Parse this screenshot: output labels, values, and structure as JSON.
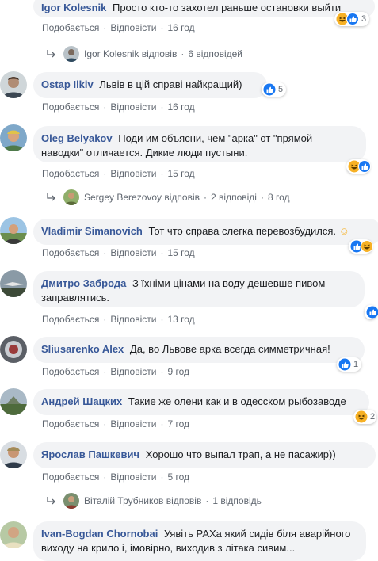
{
  "actions": {
    "like": "Подобається",
    "reply": "Відповісти",
    "dot": "·"
  },
  "comments": [
    {
      "author": "Igor Kolesnik",
      "text": "Просто кто-то захотел раньше остановки выйти",
      "time": "16 год",
      "reactions": "3"
    },
    {
      "author": "Ostap Ilkiv",
      "text": "Львів в цій справі найкращий)",
      "time": "16 год",
      "reactions": "5"
    },
    {
      "author": "Oleg Belyakov",
      "text": "Поди им объясни, чем \"арка\" от \"прямой наводки\" отличается. Дикие люди пустыни.",
      "time": "15 год"
    },
    {
      "author": "Vladimir Simanovich",
      "text": "Тот что справа слегка перевозбудился.",
      "time": "15 год"
    },
    {
      "author": "Дмитро Заброда",
      "text": "З їхніми цінами на воду дешевше пивом заправлятись.",
      "time": "13 год"
    },
    {
      "author": "Sliusarenko Alex",
      "text": "Да, во Львове арка всегда симметричная!",
      "time": "9 год",
      "reactions": "1"
    },
    {
      "author": "Андрей Шацких",
      "text": "Такие же олени как и в одесском рыбозаводе",
      "time": "7 год",
      "reactions": "2"
    },
    {
      "author": "Ярослав Пашкевич",
      "text": "Хорошо что выпал трап, а не пасажир))",
      "time": "5 год"
    },
    {
      "author": "Ivan-Bogdan Chornobai",
      "text": "Уявіть РАХа який сидів біля аварійного виходу на крило і, імовірно, виходив з літака сивим..."
    }
  ],
  "reply_threads": [
    {
      "name": "Igor Kolesnik відповів",
      "count": "6 відповідей",
      "time": ""
    },
    {
      "name": "Sergey Berezovoy відповів",
      "count": "2 відповіді",
      "time": "8 год"
    },
    {
      "name": "Віталій Трубников відповів",
      "count": "1 відповідь",
      "time": ""
    }
  ],
  "colors": {
    "name": "#385898",
    "bubble": "#f2f3f5",
    "meta": "#606770",
    "like_blue": "#1877f2",
    "haha_yellow": "#f7b125"
  }
}
